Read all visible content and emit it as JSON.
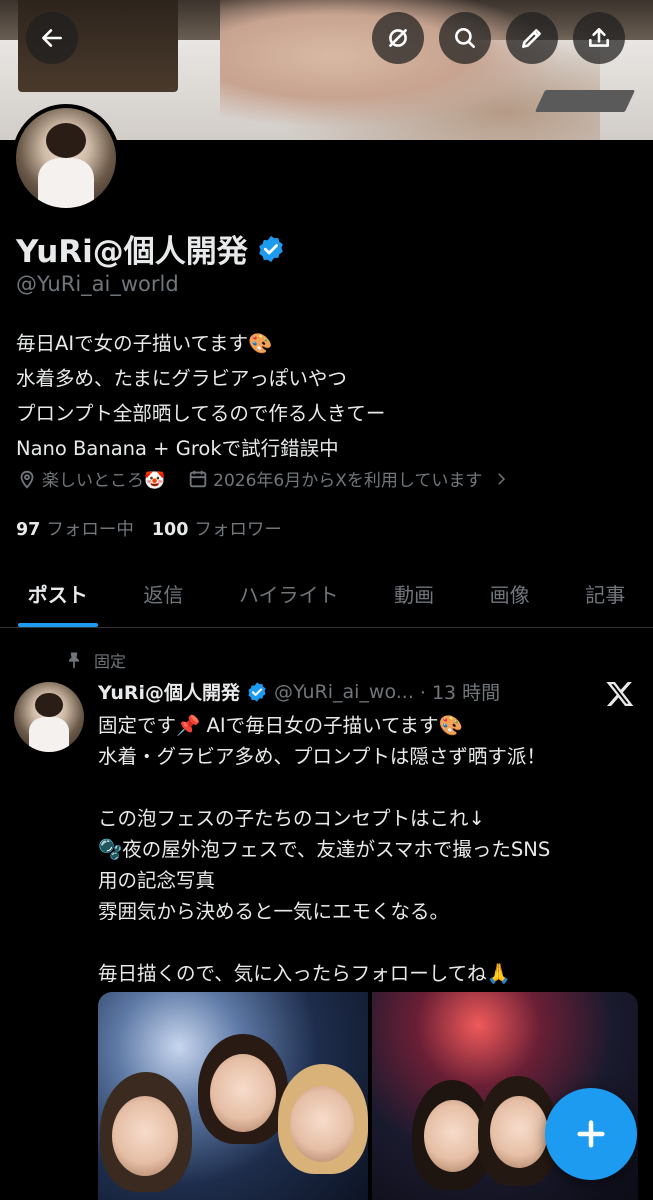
{
  "header": {
    "back": "back-arrow-icon",
    "actions": [
      "grok-icon",
      "search-icon",
      "edit-icon",
      "share-icon"
    ]
  },
  "profile": {
    "name": "YuRi@個人開発",
    "handle": "@YuRi_ai_world",
    "bio": [
      "毎日AIで女の子描いてます🎨",
      "水着多め、たまにグラビアっぽいやつ",
      "プロンプト全部晒してるので作る人きてー",
      "Nano Banana + Grokで試行錯誤中"
    ],
    "location": "楽しいところ🤡",
    "joined": "2026年6月からXを利用しています",
    "following_count": "97",
    "following_label": "フォロー中",
    "followers_count": "100",
    "followers_label": "フォロワー"
  },
  "tabs": [
    "ポスト",
    "返信",
    "ハイライト",
    "動画",
    "画像",
    "記事"
  ],
  "post": {
    "pinned_label": "固定",
    "name": "YuRi@個人開発",
    "handle": "@YuRi_ai_wo...",
    "time": "· 13 時間",
    "lines": [
      "固定です📌 AIで毎日女の子描いてます🎨",
      "水着・グラビア多め、プロンプトは隠さず晒す派！",
      "",
      "この泡フェスの子たちのコンセプトはこれ↓",
      "🫧夜の屋外泡フェスで、友達がスマホで撮ったSNS",
      "用の記念写真",
      "雰囲気から決めると一気にエモくなる。",
      "",
      "毎日描くので、気に入ったらフォローしてね🙏"
    ]
  },
  "colors": {
    "accent": "#1d9bf0",
    "text": "#e7e9ea",
    "muted": "#71767b",
    "background": "#000000"
  }
}
